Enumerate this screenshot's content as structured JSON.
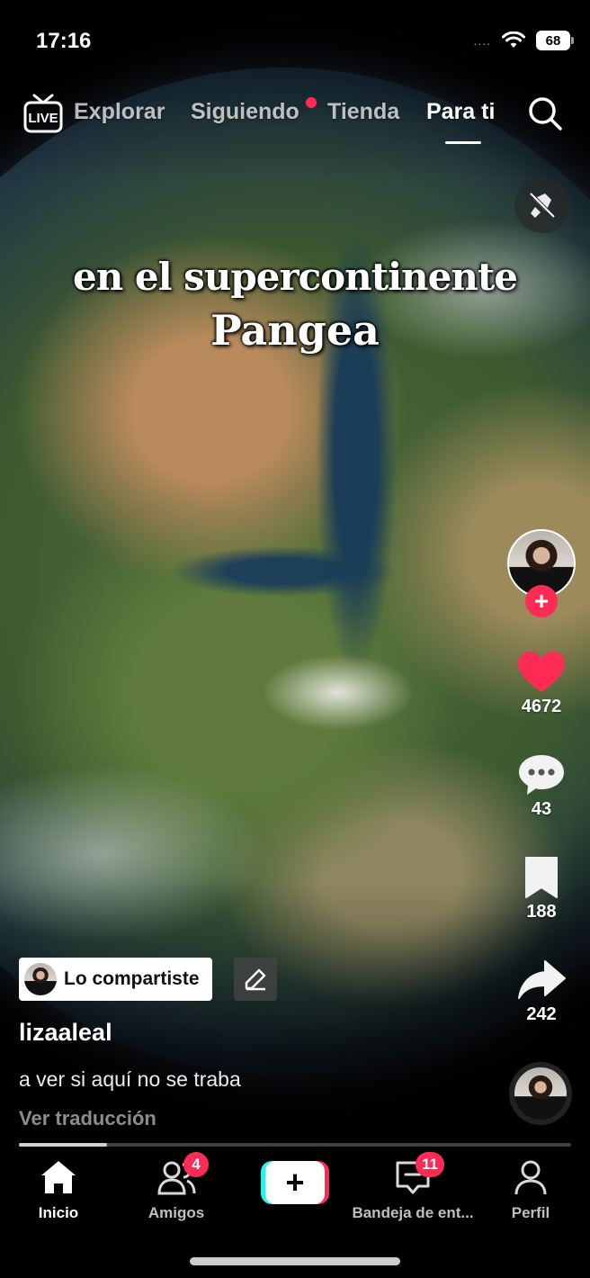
{
  "status_bar": {
    "time": "17:16",
    "signal": "....",
    "battery": "68"
  },
  "top_nav": {
    "live_label": "LIVE",
    "tabs": [
      {
        "label": "Explorar"
      },
      {
        "label": "Siguiendo"
      },
      {
        "label": "Tienda"
      },
      {
        "label": "Para ti",
        "active": true
      }
    ]
  },
  "video": {
    "caption_line1": "en el supercontinente",
    "caption_line2": "Pangea",
    "progress": 0.16
  },
  "right_rail": {
    "like_count": "4672",
    "comment_count": "43",
    "bookmark_count": "188",
    "share_count": "242"
  },
  "post": {
    "shared_label": "Lo compartiste",
    "username": "lizaaleal",
    "description": "a ver si aquí no se traba",
    "translate_label": "Ver traducción"
  },
  "bottom_nav": {
    "home": "Inicio",
    "friends": "Amigos",
    "friends_badge": "4",
    "inbox": "Bandeja de ent...",
    "inbox_badge": "11",
    "profile": "Perfil",
    "create": "+"
  },
  "colors": {
    "accent": "#fe2c55",
    "cyan": "#25f4ee"
  }
}
